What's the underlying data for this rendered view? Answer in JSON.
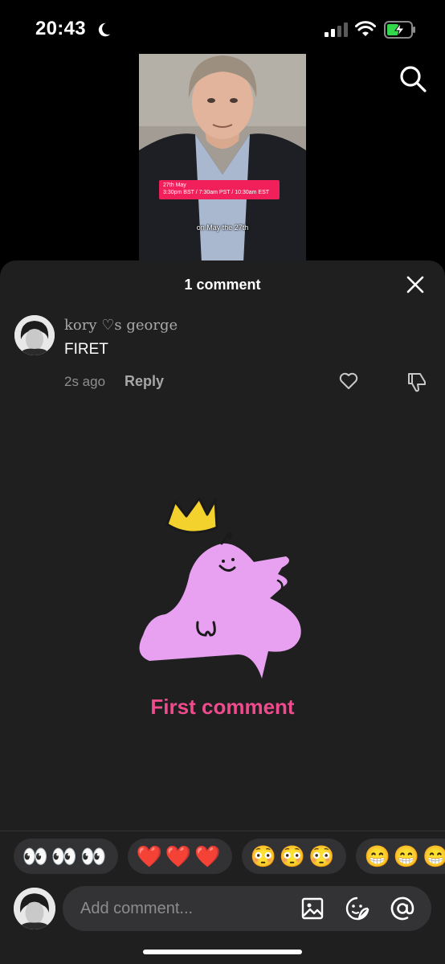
{
  "status_bar": {
    "time": "20:43",
    "icons": [
      "moon-icon",
      "signal-icon",
      "wifi-icon",
      "battery-charging-icon"
    ]
  },
  "video": {
    "banner_line1": "27th May",
    "banner_line2": "3:30pm BST / 7:30am PST / 10:30am EST",
    "caption": "on May the 27th"
  },
  "sheet": {
    "title": "1 comment",
    "comments": [
      {
        "username": "kory ♡s george",
        "text": "FIRET",
        "time": "2s ago",
        "reply_label": "Reply"
      }
    ],
    "badge_text": "First comment"
  },
  "emoji_bar": {
    "items": [
      "👀👀👀",
      "❤️❤️❤️",
      "😳😳😳",
      "😁😁😁"
    ]
  },
  "composer": {
    "placeholder": "Add comment..."
  },
  "colors": {
    "sheet_bg": "#1f1f20",
    "accent_pink": "#f04b8d",
    "banner_red": "#f2205a"
  }
}
